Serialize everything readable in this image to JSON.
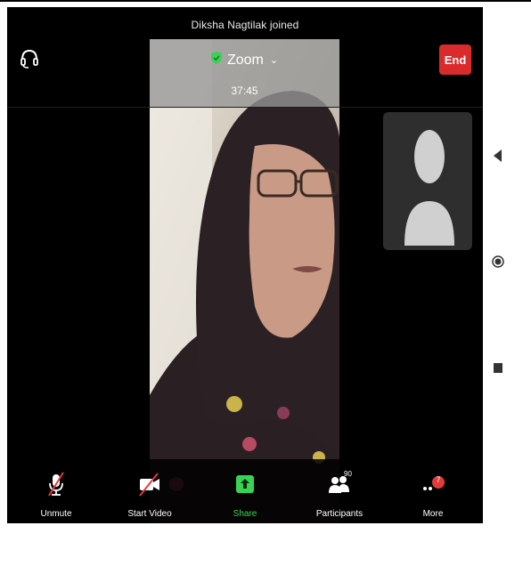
{
  "notification": "Diksha Nagtilak joined",
  "header": {
    "meeting_name": "Zoom",
    "timer": "37:45",
    "end_label": "End"
  },
  "toolbar": {
    "unmute_label": "Unmute",
    "start_video_label": "Start Video",
    "share_label": "Share",
    "participants_label": "Participants",
    "participants_count": "90",
    "more_label": "More",
    "more_badge": "7"
  },
  "colors": {
    "end_button": "#d92b2b",
    "share_accent": "#39d353",
    "badge": "#e23b3b",
    "background": "#000000"
  },
  "icons": {
    "audio": "headset-icon",
    "unmute": "microphone-muted-icon",
    "video": "video-camera-off-icon",
    "share": "share-arrow-icon",
    "participants": "participants-icon",
    "more": "more-dots-icon",
    "side_back": "back-triangle-icon",
    "side_home": "home-circle-icon",
    "side_recent": "recent-square-icon"
  }
}
